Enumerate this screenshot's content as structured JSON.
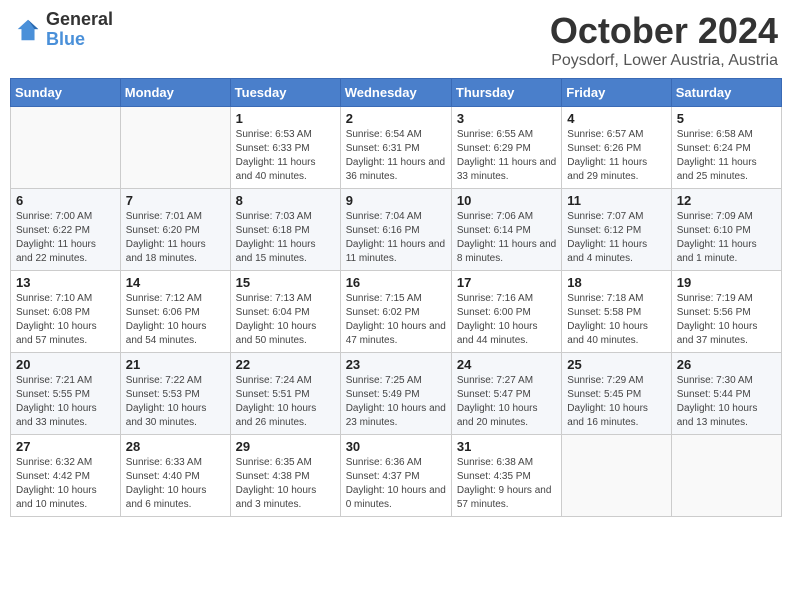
{
  "header": {
    "logo_general": "General",
    "logo_blue": "Blue",
    "month": "October 2024",
    "location": "Poysdorf, Lower Austria, Austria"
  },
  "weekdays": [
    "Sunday",
    "Monday",
    "Tuesday",
    "Wednesday",
    "Thursday",
    "Friday",
    "Saturday"
  ],
  "weeks": [
    [
      {
        "day": "",
        "info": ""
      },
      {
        "day": "",
        "info": ""
      },
      {
        "day": "1",
        "info": "Sunrise: 6:53 AM\nSunset: 6:33 PM\nDaylight: 11 hours and 40 minutes."
      },
      {
        "day": "2",
        "info": "Sunrise: 6:54 AM\nSunset: 6:31 PM\nDaylight: 11 hours and 36 minutes."
      },
      {
        "day": "3",
        "info": "Sunrise: 6:55 AM\nSunset: 6:29 PM\nDaylight: 11 hours and 33 minutes."
      },
      {
        "day": "4",
        "info": "Sunrise: 6:57 AM\nSunset: 6:26 PM\nDaylight: 11 hours and 29 minutes."
      },
      {
        "day": "5",
        "info": "Sunrise: 6:58 AM\nSunset: 6:24 PM\nDaylight: 11 hours and 25 minutes."
      }
    ],
    [
      {
        "day": "6",
        "info": "Sunrise: 7:00 AM\nSunset: 6:22 PM\nDaylight: 11 hours and 22 minutes."
      },
      {
        "day": "7",
        "info": "Sunrise: 7:01 AM\nSunset: 6:20 PM\nDaylight: 11 hours and 18 minutes."
      },
      {
        "day": "8",
        "info": "Sunrise: 7:03 AM\nSunset: 6:18 PM\nDaylight: 11 hours and 15 minutes."
      },
      {
        "day": "9",
        "info": "Sunrise: 7:04 AM\nSunset: 6:16 PM\nDaylight: 11 hours and 11 minutes."
      },
      {
        "day": "10",
        "info": "Sunrise: 7:06 AM\nSunset: 6:14 PM\nDaylight: 11 hours and 8 minutes."
      },
      {
        "day": "11",
        "info": "Sunrise: 7:07 AM\nSunset: 6:12 PM\nDaylight: 11 hours and 4 minutes."
      },
      {
        "day": "12",
        "info": "Sunrise: 7:09 AM\nSunset: 6:10 PM\nDaylight: 11 hours and 1 minute."
      }
    ],
    [
      {
        "day": "13",
        "info": "Sunrise: 7:10 AM\nSunset: 6:08 PM\nDaylight: 10 hours and 57 minutes."
      },
      {
        "day": "14",
        "info": "Sunrise: 7:12 AM\nSunset: 6:06 PM\nDaylight: 10 hours and 54 minutes."
      },
      {
        "day": "15",
        "info": "Sunrise: 7:13 AM\nSunset: 6:04 PM\nDaylight: 10 hours and 50 minutes."
      },
      {
        "day": "16",
        "info": "Sunrise: 7:15 AM\nSunset: 6:02 PM\nDaylight: 10 hours and 47 minutes."
      },
      {
        "day": "17",
        "info": "Sunrise: 7:16 AM\nSunset: 6:00 PM\nDaylight: 10 hours and 44 minutes."
      },
      {
        "day": "18",
        "info": "Sunrise: 7:18 AM\nSunset: 5:58 PM\nDaylight: 10 hours and 40 minutes."
      },
      {
        "day": "19",
        "info": "Sunrise: 7:19 AM\nSunset: 5:56 PM\nDaylight: 10 hours and 37 minutes."
      }
    ],
    [
      {
        "day": "20",
        "info": "Sunrise: 7:21 AM\nSunset: 5:55 PM\nDaylight: 10 hours and 33 minutes."
      },
      {
        "day": "21",
        "info": "Sunrise: 7:22 AM\nSunset: 5:53 PM\nDaylight: 10 hours and 30 minutes."
      },
      {
        "day": "22",
        "info": "Sunrise: 7:24 AM\nSunset: 5:51 PM\nDaylight: 10 hours and 26 minutes."
      },
      {
        "day": "23",
        "info": "Sunrise: 7:25 AM\nSunset: 5:49 PM\nDaylight: 10 hours and 23 minutes."
      },
      {
        "day": "24",
        "info": "Sunrise: 7:27 AM\nSunset: 5:47 PM\nDaylight: 10 hours and 20 minutes."
      },
      {
        "day": "25",
        "info": "Sunrise: 7:29 AM\nSunset: 5:45 PM\nDaylight: 10 hours and 16 minutes."
      },
      {
        "day": "26",
        "info": "Sunrise: 7:30 AM\nSunset: 5:44 PM\nDaylight: 10 hours and 13 minutes."
      }
    ],
    [
      {
        "day": "27",
        "info": "Sunrise: 6:32 AM\nSunset: 4:42 PM\nDaylight: 10 hours and 10 minutes."
      },
      {
        "day": "28",
        "info": "Sunrise: 6:33 AM\nSunset: 4:40 PM\nDaylight: 10 hours and 6 minutes."
      },
      {
        "day": "29",
        "info": "Sunrise: 6:35 AM\nSunset: 4:38 PM\nDaylight: 10 hours and 3 minutes."
      },
      {
        "day": "30",
        "info": "Sunrise: 6:36 AM\nSunset: 4:37 PM\nDaylight: 10 hours and 0 minutes."
      },
      {
        "day": "31",
        "info": "Sunrise: 6:38 AM\nSunset: 4:35 PM\nDaylight: 9 hours and 57 minutes."
      },
      {
        "day": "",
        "info": ""
      },
      {
        "day": "",
        "info": ""
      }
    ]
  ]
}
